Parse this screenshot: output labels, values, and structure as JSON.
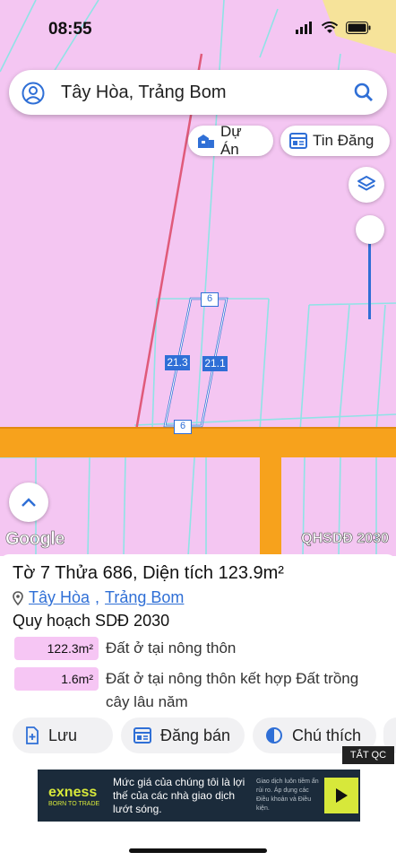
{
  "status_bar": {
    "time": "08:55",
    "icons": [
      "signal-icon",
      "wifi-icon",
      "battery-icon"
    ]
  },
  "search": {
    "query": "Tây Hòa, Trảng Bom",
    "account_icon": "account-icon",
    "search_icon": "search-icon"
  },
  "chips": [
    {
      "label": "Dự Án",
      "icon": "building-icon"
    },
    {
      "label": "Tin Đăng",
      "icon": "listing-icon"
    }
  ],
  "map": {
    "measurements": {
      "top": "6",
      "left": "21.3",
      "right": "21.1",
      "bottom": "6"
    },
    "attribution": "Google",
    "layer_name": "QHSDĐ 2030",
    "colors": {
      "land": "#f4c6f2",
      "road": "#f7a21c",
      "parcel_line": "#8fe3e6",
      "highlight": "#2f6fd6"
    }
  },
  "parcel": {
    "title": "Tờ 7 Thửa 686, Diện tích 123.9m²",
    "ward": "Tây Hòa",
    "separator": ",",
    "district": "Trảng Bom",
    "plan_label": "Quy hoạch SDĐ 2030",
    "zones": [
      {
        "area": "122.3m²",
        "desc": "Đất ở tại nông thôn"
      },
      {
        "area": "1.6m²",
        "desc": "Đất ở tại nông thôn kết hợp Đất trồng cây lâu năm"
      }
    ]
  },
  "actions": [
    {
      "label": "Lưu",
      "icon": "bookmark-add-icon"
    },
    {
      "label": "Đăng bán",
      "icon": "listing-icon"
    },
    {
      "label": "Chú thích",
      "icon": "legend-icon"
    }
  ],
  "ad": {
    "close_label": "TẮT QC",
    "brand": "exness",
    "tagline": "BORN TO TRADE",
    "main_text": "Mức giá của chúng tôi là lợi thế của các nhà giao dịch lướt sóng.",
    "side_text": "Giao dịch luôn tiềm ẩn rủi ro. Áp dụng các Điều khoản và Điều kiện."
  }
}
